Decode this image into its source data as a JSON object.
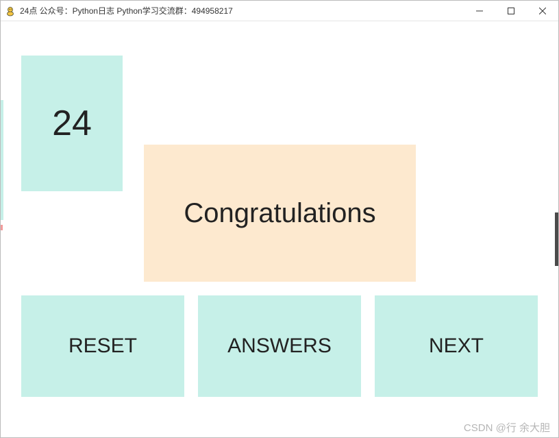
{
  "window": {
    "title": "24点 公众号：Python日志 Python学习交流群：494958217"
  },
  "game": {
    "card_value": "24",
    "message": "Congratulations"
  },
  "buttons": {
    "reset": "RESET",
    "answers": "ANSWERS",
    "next": "NEXT"
  },
  "watermark": "CSDN @行 余大胆"
}
